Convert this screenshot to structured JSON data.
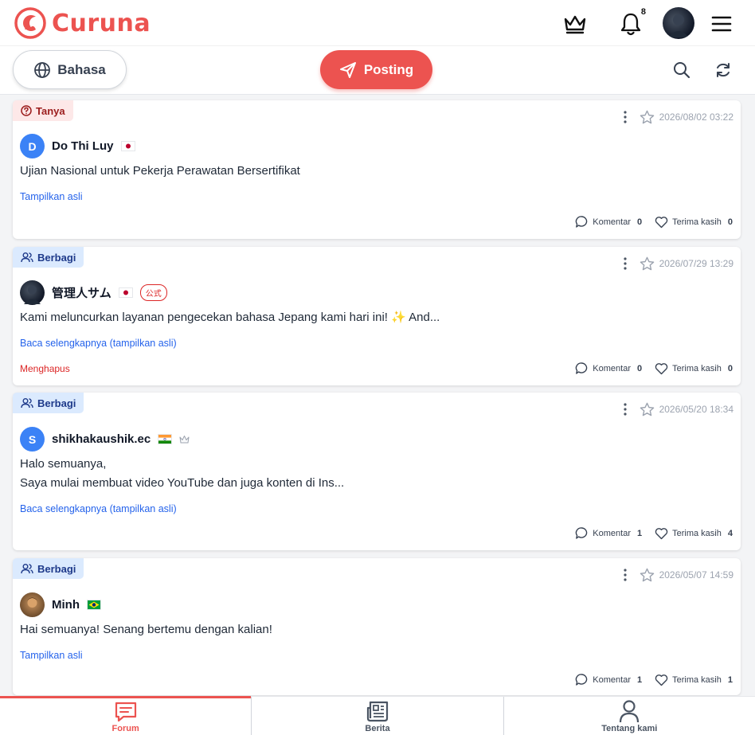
{
  "app": {
    "name": "Curuna",
    "accent": "#ec5350"
  },
  "header": {
    "notification_count": "8"
  },
  "toolbar": {
    "language_label": "Bahasa",
    "post_label": "Posting"
  },
  "posts": [
    {
      "tag": "Tanya",
      "date": "2026/08/02 03:22",
      "author": "Do Thi Luy",
      "avatar_initial": "D",
      "flag": "japan-flag",
      "lines": [
        "Ujian Nasional untuk Pekerja Perawatan Bersertifikat"
      ],
      "link": "Tampilkan asli",
      "comment_label": "Komentar",
      "comment_count": "0",
      "thanks_label": "Terima kasih",
      "thanks_count": "0"
    },
    {
      "tag": "Berbagi",
      "date": "2026/07/29 13:29",
      "author": "管理人サム",
      "badge": "公式",
      "flag": "japan-flag",
      "lines": [
        "Kami meluncurkan layanan pengecekan bahasa Jepang kami hari ini! ✨ And..."
      ],
      "link": "Baca selengkapnya (tampilkan asli)",
      "delete_label": "Menghapus",
      "comment_label": "Komentar",
      "comment_count": "0",
      "thanks_label": "Terima kasih",
      "thanks_count": "0"
    },
    {
      "tag": "Berbagi",
      "date": "2026/05/20 18:34",
      "author": "shikhakaushik.ec",
      "avatar_initial": "S",
      "flag": "india-flag",
      "lines": [
        "Halo semuanya,",
        "Saya mulai membuat video YouTube dan juga konten di Ins..."
      ],
      "link": "Baca selengkapnya (tampilkan asli)",
      "comment_label": "Komentar",
      "comment_count": "1",
      "thanks_label": "Terima kasih",
      "thanks_count": "4"
    },
    {
      "tag": "Berbagi",
      "date": "2026/05/07 14:59",
      "author": "Minh",
      "flag": "brazil-flag",
      "lines": [
        "Hai semuanya! Senang bertemu dengan kalian!"
      ],
      "link": "Tampilkan asli",
      "comment_label": "Komentar",
      "comment_count": "1",
      "thanks_label": "Terima kasih",
      "thanks_count": "1"
    }
  ],
  "bottom_nav": [
    {
      "label": "Forum",
      "icon": "forum-icon",
      "active": true
    },
    {
      "label": "Berita",
      "icon": "news-icon",
      "active": false
    },
    {
      "label": "Tentang kami",
      "icon": "person-icon",
      "active": false
    }
  ]
}
